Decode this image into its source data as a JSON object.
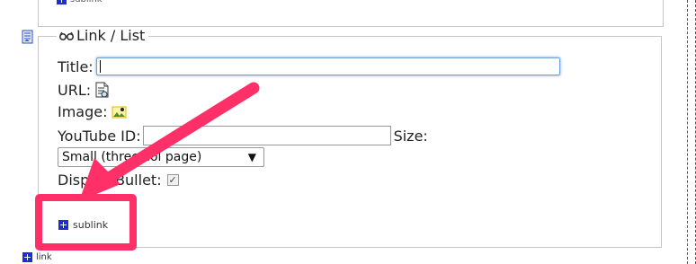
{
  "upper": {
    "sublink_label": "sublink"
  },
  "fieldset": {
    "legend": "Link / List",
    "fields": {
      "title_label": "Title:",
      "url_label": "URL:",
      "image_label": "Image:",
      "youtube_label": "YouTube ID:",
      "size_label": "Size:",
      "size_value": "Small (three col page)",
      "display_bullet_label": "Display Bullet:"
    },
    "sublink_label": "sublink"
  },
  "bottom": {
    "link_label": "link"
  },
  "icons": {
    "page": "page-list-icon",
    "legend": "link-glasses-icon",
    "url": "document-browse-icon",
    "image": "image-browse-icon",
    "plus": "plus-icon"
  },
  "colors": {
    "annotation": "#ff2f68",
    "plus": "#1b2fd6",
    "focus_border": "#6fa0d8"
  },
  "states": {
    "display_bullet_checked": true
  }
}
